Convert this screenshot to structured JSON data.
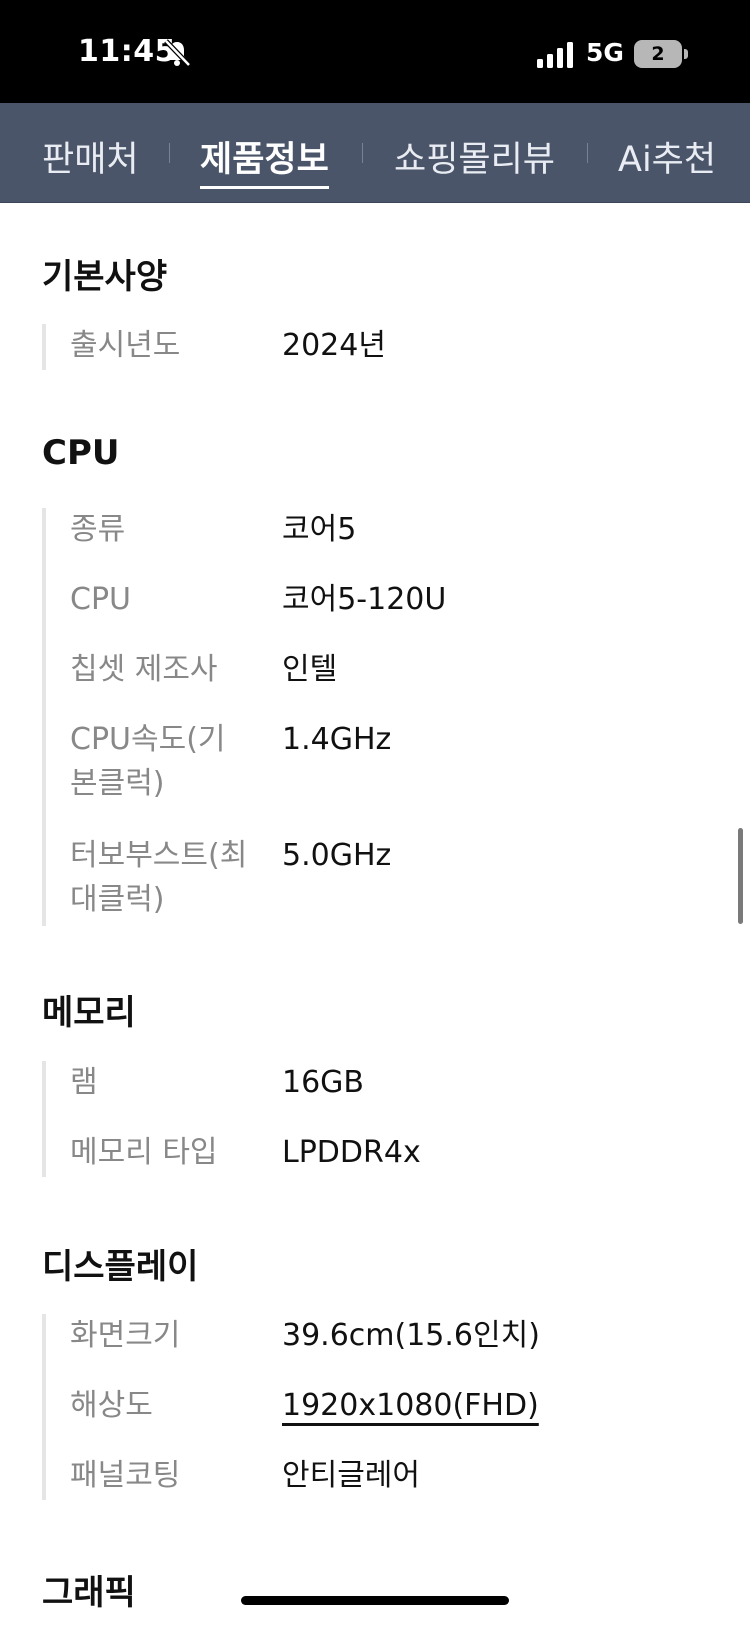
{
  "status_bar": {
    "time": "11:45",
    "network": "5G",
    "battery": "2"
  },
  "tabs": [
    {
      "label": "판매처",
      "active": false
    },
    {
      "label": "제품정보",
      "active": true
    },
    {
      "label": "쇼핑몰리뷰",
      "active": false
    },
    {
      "label": "Ai추천",
      "active": false
    }
  ],
  "sections": {
    "basic": {
      "title": "기본사양",
      "rows": [
        {
          "label": "출시년도",
          "value": "2024년"
        }
      ]
    },
    "cpu": {
      "title": "CPU",
      "rows": [
        {
          "label": "종류",
          "value": "코어5"
        },
        {
          "label": "CPU",
          "value": "코어5-120U"
        },
        {
          "label": "칩셋 제조사",
          "value": "인텔"
        },
        {
          "label_line1": "CPU속도(기",
          "label_line2": "본클럭)",
          "value": "1.4GHz"
        },
        {
          "label_line1": "터보부스트(최",
          "label_line2": "대클럭)",
          "value": "5.0GHz"
        }
      ]
    },
    "memory": {
      "title": "메모리",
      "rows": [
        {
          "label": "램",
          "value": "16GB"
        },
        {
          "label": "메모리 타입",
          "value": "LPDDR4x"
        }
      ]
    },
    "display": {
      "title": "디스플레이",
      "rows": [
        {
          "label": "화면크기",
          "value": "39.6cm(15.6인치)"
        },
        {
          "label": "해상도",
          "value": "1920x1080(FHD)"
        },
        {
          "label": "패널코팅",
          "value": "안티글레어"
        }
      ]
    },
    "graphics": {
      "title": "그래픽"
    }
  }
}
